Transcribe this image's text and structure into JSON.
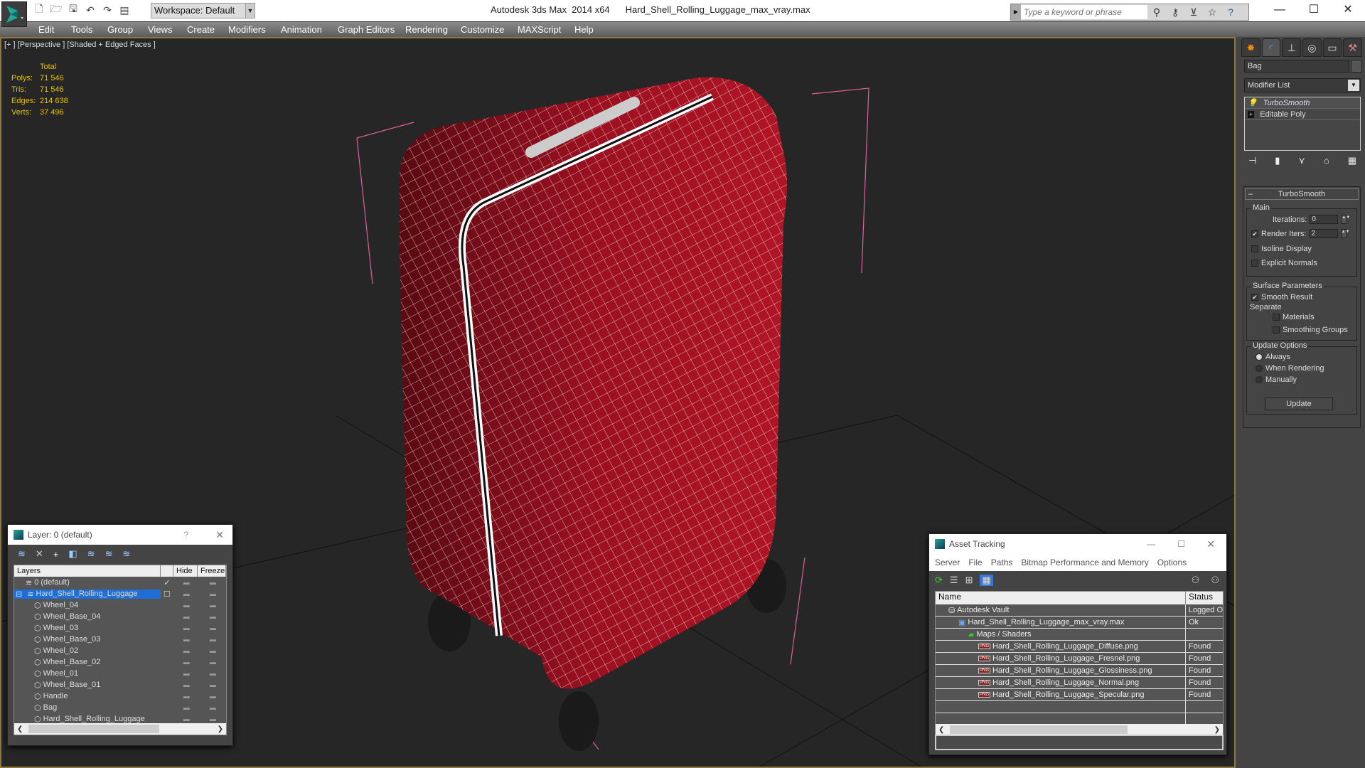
{
  "app": {
    "title": "Autodesk 3ds Max  2014 x64",
    "file": "Hard_Shell_Rolling_Luggage_max_vray.max",
    "workspace": "Workspace: Default",
    "search_placeholder": "Type a keyword or phrase"
  },
  "menu": [
    "Edit",
    "Tools",
    "Group",
    "Views",
    "Create",
    "Modifiers",
    "Animation",
    "Graph Editors",
    "Rendering",
    "Customize",
    "MAXScript",
    "Help"
  ],
  "viewport": {
    "label": "[+ ] [Perspective ] [Shaded + Edged Faces ]",
    "stats": {
      "header": "Total",
      "rows": [
        {
          "k": "Polys:",
          "v": "71 546"
        },
        {
          "k": "Tris:",
          "v": "71 546"
        },
        {
          "k": "Edges:",
          "v": "214 638"
        },
        {
          "k": "Verts:",
          "v": "37 496"
        }
      ]
    }
  },
  "command_panel": {
    "object_name": "Bag",
    "modifier_list": "Modifier List",
    "stack": [
      "TurboSmooth",
      "Editable Poly"
    ],
    "rollout": {
      "title": "TurboSmooth",
      "main_label": "Main",
      "iterations_label": "Iterations:",
      "iterations": "0",
      "render_iters_label": "Render Iters:",
      "render_iters": "2",
      "render_iters_checked": true,
      "isoline": "Isoline Display",
      "explicit_normals": "Explicit Normals",
      "surface_params": "Surface Parameters",
      "smooth_result": "Smooth Result",
      "separate": "Separate",
      "materials": "Materials",
      "smoothing_groups": "Smoothing Groups",
      "update_options": "Update Options",
      "always": "Always",
      "when_rendering": "When Rendering",
      "manually": "Manually",
      "update_button": "Update"
    }
  },
  "layer_dialog": {
    "title": "Layer: 0 (default)",
    "help": "?",
    "columns": [
      "Layers",
      "Hide",
      "Freeze"
    ],
    "rows": [
      {
        "name": "0 (default)",
        "level": 0,
        "type": "layer",
        "checked": true
      },
      {
        "name": "Hard_Shell_Rolling_Luggage",
        "level": 0,
        "type": "layer",
        "selected": true
      },
      {
        "name": "Wheel_04",
        "level": 1,
        "type": "object"
      },
      {
        "name": "Wheel_Base_04",
        "level": 1,
        "type": "object"
      },
      {
        "name": "Wheel_03",
        "level": 1,
        "type": "object"
      },
      {
        "name": "Wheel_Base_03",
        "level": 1,
        "type": "object"
      },
      {
        "name": "Wheel_02",
        "level": 1,
        "type": "object"
      },
      {
        "name": "Wheel_Base_02",
        "level": 1,
        "type": "object"
      },
      {
        "name": "Wheel_01",
        "level": 1,
        "type": "object"
      },
      {
        "name": "Wheel_Base_01",
        "level": 1,
        "type": "object"
      },
      {
        "name": "Handle",
        "level": 1,
        "type": "object"
      },
      {
        "name": "Bag",
        "level": 1,
        "type": "object"
      },
      {
        "name": "Hard_Shell_Rolling_Luggage",
        "level": 1,
        "type": "object"
      }
    ]
  },
  "asset_dialog": {
    "title": "Asset Tracking",
    "menu": [
      "Server",
      "File",
      "Paths",
      "Bitmap Performance and Memory",
      "Options"
    ],
    "columns": [
      "Name",
      "Status"
    ],
    "rows": [
      {
        "name": "Autodesk Vault",
        "status": "Logged O",
        "level": 0,
        "icon": "vault"
      },
      {
        "name": "Hard_Shell_Rolling_Luggage_max_vray.max",
        "status": "Ok",
        "level": 1,
        "icon": "max"
      },
      {
        "name": "Maps / Shaders",
        "status": "",
        "level": 2,
        "icon": "maps"
      },
      {
        "name": "Hard_Shell_Rolling_Luggage_Diffuse.png",
        "status": "Found",
        "level": 3,
        "icon": "png"
      },
      {
        "name": "Hard_Shell_Rolling_Luggage_Fresnel.png",
        "status": "Found",
        "level": 3,
        "icon": "png"
      },
      {
        "name": "Hard_Shell_Rolling_Luggage_Glossiness.png",
        "status": "Found",
        "level": 3,
        "icon": "png"
      },
      {
        "name": "Hard_Shell_Rolling_Luggage_Normal.png",
        "status": "Found",
        "level": 3,
        "icon": "png"
      },
      {
        "name": "Hard_Shell_Rolling_Luggage_Specular.png",
        "status": "Found",
        "level": 3,
        "icon": "png"
      }
    ]
  }
}
